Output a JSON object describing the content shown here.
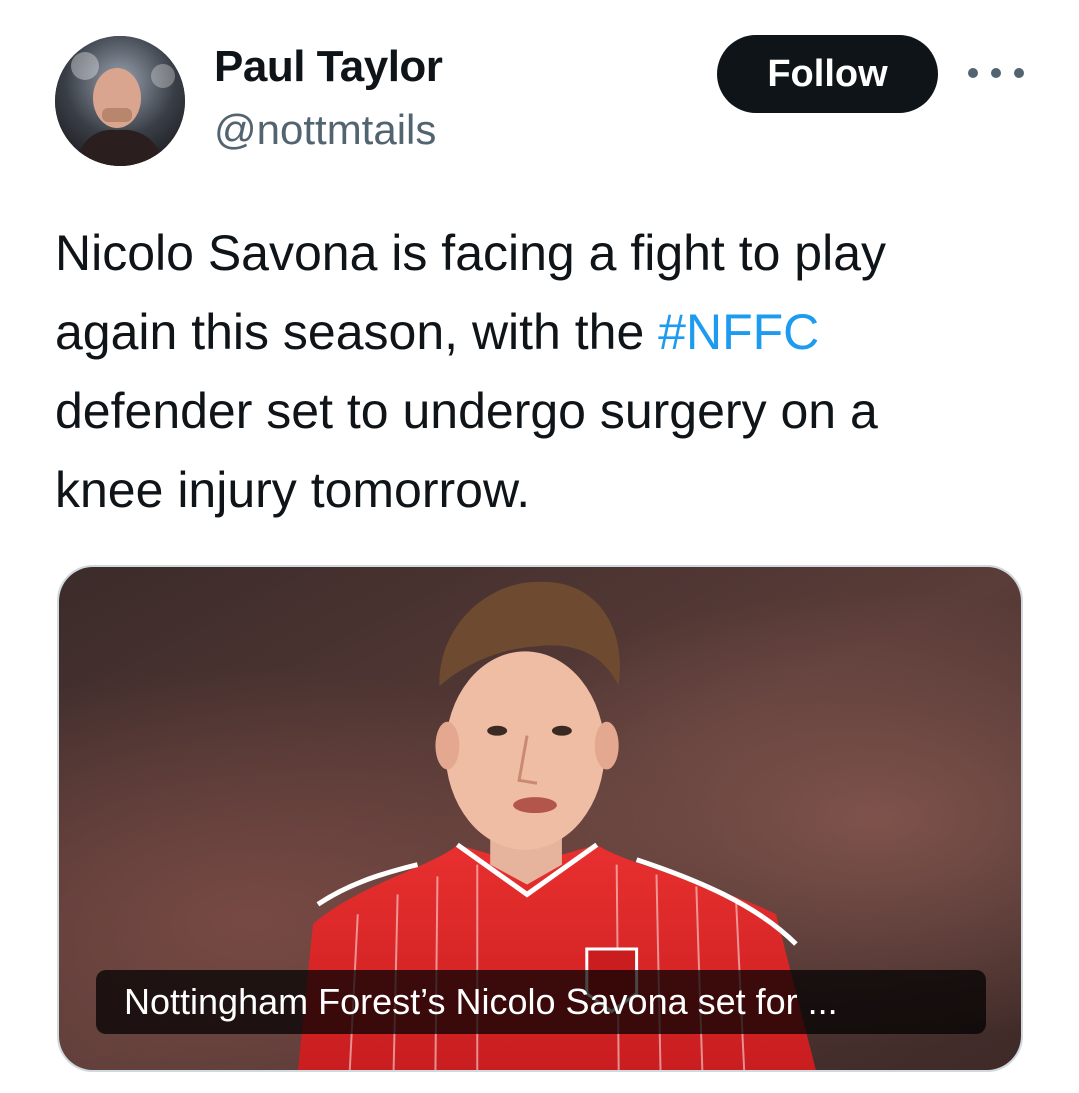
{
  "user": {
    "name": "Paul Taylor",
    "handle": "@nottmtails"
  },
  "follow_label": "Follow",
  "tweet": {
    "lines": [
      "Nicolo Savona is facing a fight to play",
      "again this season, with the ",
      "defender set to undergo surgery on a",
      "knee injury tomorrow."
    ],
    "hashtag": "#NFFC"
  },
  "card": {
    "caption": "Nottingham Forest’s Nicolo Savona set for ..."
  },
  "colors": {
    "hashtag": "#1d9bf0",
    "follow_bg": "#0f1419",
    "secondary_text": "#536471",
    "jersey": "#e0282a"
  },
  "icons": {
    "more": "more-icon"
  }
}
